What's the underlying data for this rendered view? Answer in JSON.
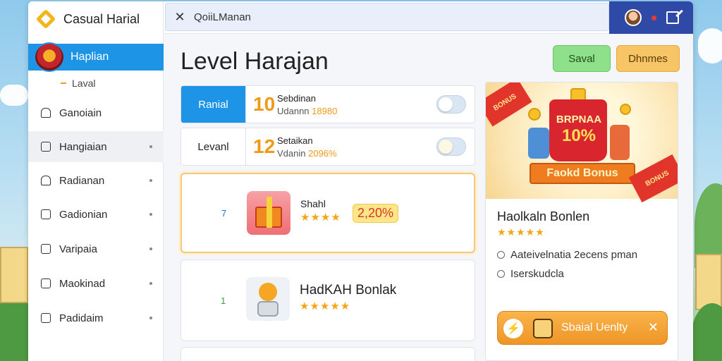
{
  "app": {
    "title": "Casual Harial"
  },
  "sidebar": {
    "active_item": "Haplian",
    "sub_item": "Laval",
    "items": [
      {
        "label": "Ganoiain",
        "icon": "bell-icon"
      },
      {
        "label": "Hangiaian",
        "icon": "grid-icon"
      },
      {
        "label": "Radianan",
        "icon": "bell-icon"
      },
      {
        "label": "Gadionian",
        "icon": "calendar-icon"
      },
      {
        "label": "Varipaia",
        "icon": "gift-icon"
      },
      {
        "label": "Maokinad",
        "icon": "image-icon"
      },
      {
        "label": "Padidaim",
        "icon": "document-icon"
      }
    ]
  },
  "topbar": {
    "search_value": "QoiiLManan"
  },
  "main": {
    "title": "Level Harajan",
    "save_label": "Saval",
    "bonus_label": "Dhnmes",
    "rows": [
      {
        "tab": "Ranial",
        "num": "10",
        "name": "Sebdinan",
        "sub_prefix": "Udannn",
        "sub_value": "18980",
        "active": true
      },
      {
        "tab": "Levanl",
        "num": "12",
        "name": "Setaikan",
        "sub_prefix": "Vdanin",
        "sub_value": "2096%",
        "active": false
      }
    ],
    "cards": [
      {
        "rank": "7",
        "title": "Shahl",
        "stars": "★★★★",
        "percent": "2,20%",
        "image": "gift-box-icon"
      },
      {
        "rank": "1",
        "title": "HadKAH Bonlak",
        "stars": "★★★★★",
        "image": "robot-chick-icon"
      }
    ]
  },
  "promo": {
    "ribbon_left": "BONUS",
    "bag_text": "BRPNAA",
    "bag_percent": "10%",
    "banner": "Faokd Bonus",
    "ribbon_right": "BONUS",
    "title": "Haolkaln Bonlen",
    "stars": "★★★★★",
    "lines": [
      "Aateivelnatia 2ecens pman",
      "Iserskudcla"
    ],
    "cta_label": "Sbaial Uenlty"
  },
  "colors": {
    "accent": "#1e94e6",
    "topbar_right": "#2f49a6",
    "save": "#8fe08a",
    "bonus": "#f7c565",
    "highlight_orange": "#f09a1a"
  }
}
